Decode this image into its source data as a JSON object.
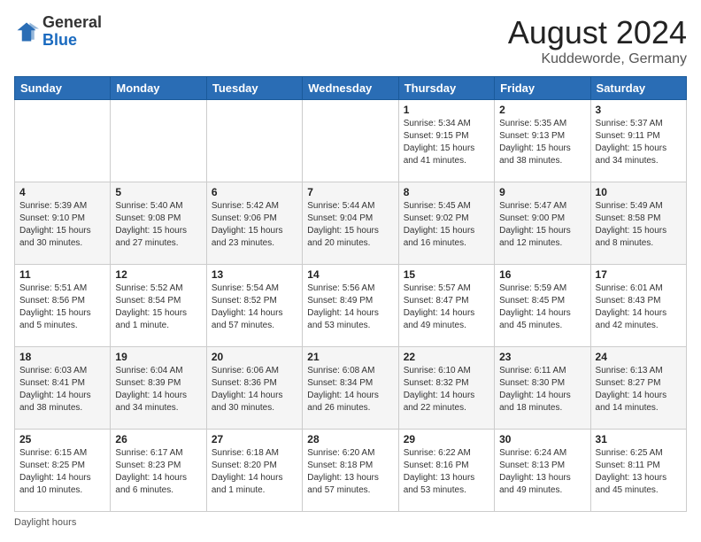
{
  "header": {
    "logo_general": "General",
    "logo_blue": "Blue",
    "month_year": "August 2024",
    "location": "Kuddeworde, Germany"
  },
  "days_of_week": [
    "Sunday",
    "Monday",
    "Tuesday",
    "Wednesday",
    "Thursday",
    "Friday",
    "Saturday"
  ],
  "weeks": [
    [
      {
        "day": "",
        "info": ""
      },
      {
        "day": "",
        "info": ""
      },
      {
        "day": "",
        "info": ""
      },
      {
        "day": "",
        "info": ""
      },
      {
        "day": "1",
        "info": "Sunrise: 5:34 AM\nSunset: 9:15 PM\nDaylight: 15 hours\nand 41 minutes."
      },
      {
        "day": "2",
        "info": "Sunrise: 5:35 AM\nSunset: 9:13 PM\nDaylight: 15 hours\nand 38 minutes."
      },
      {
        "day": "3",
        "info": "Sunrise: 5:37 AM\nSunset: 9:11 PM\nDaylight: 15 hours\nand 34 minutes."
      }
    ],
    [
      {
        "day": "4",
        "info": "Sunrise: 5:39 AM\nSunset: 9:10 PM\nDaylight: 15 hours\nand 30 minutes."
      },
      {
        "day": "5",
        "info": "Sunrise: 5:40 AM\nSunset: 9:08 PM\nDaylight: 15 hours\nand 27 minutes."
      },
      {
        "day": "6",
        "info": "Sunrise: 5:42 AM\nSunset: 9:06 PM\nDaylight: 15 hours\nand 23 minutes."
      },
      {
        "day": "7",
        "info": "Sunrise: 5:44 AM\nSunset: 9:04 PM\nDaylight: 15 hours\nand 20 minutes."
      },
      {
        "day": "8",
        "info": "Sunrise: 5:45 AM\nSunset: 9:02 PM\nDaylight: 15 hours\nand 16 minutes."
      },
      {
        "day": "9",
        "info": "Sunrise: 5:47 AM\nSunset: 9:00 PM\nDaylight: 15 hours\nand 12 minutes."
      },
      {
        "day": "10",
        "info": "Sunrise: 5:49 AM\nSunset: 8:58 PM\nDaylight: 15 hours\nand 8 minutes."
      }
    ],
    [
      {
        "day": "11",
        "info": "Sunrise: 5:51 AM\nSunset: 8:56 PM\nDaylight: 15 hours\nand 5 minutes."
      },
      {
        "day": "12",
        "info": "Sunrise: 5:52 AM\nSunset: 8:54 PM\nDaylight: 15 hours\nand 1 minute."
      },
      {
        "day": "13",
        "info": "Sunrise: 5:54 AM\nSunset: 8:52 PM\nDaylight: 14 hours\nand 57 minutes."
      },
      {
        "day": "14",
        "info": "Sunrise: 5:56 AM\nSunset: 8:49 PM\nDaylight: 14 hours\nand 53 minutes."
      },
      {
        "day": "15",
        "info": "Sunrise: 5:57 AM\nSunset: 8:47 PM\nDaylight: 14 hours\nand 49 minutes."
      },
      {
        "day": "16",
        "info": "Sunrise: 5:59 AM\nSunset: 8:45 PM\nDaylight: 14 hours\nand 45 minutes."
      },
      {
        "day": "17",
        "info": "Sunrise: 6:01 AM\nSunset: 8:43 PM\nDaylight: 14 hours\nand 42 minutes."
      }
    ],
    [
      {
        "day": "18",
        "info": "Sunrise: 6:03 AM\nSunset: 8:41 PM\nDaylight: 14 hours\nand 38 minutes."
      },
      {
        "day": "19",
        "info": "Sunrise: 6:04 AM\nSunset: 8:39 PM\nDaylight: 14 hours\nand 34 minutes."
      },
      {
        "day": "20",
        "info": "Sunrise: 6:06 AM\nSunset: 8:36 PM\nDaylight: 14 hours\nand 30 minutes."
      },
      {
        "day": "21",
        "info": "Sunrise: 6:08 AM\nSunset: 8:34 PM\nDaylight: 14 hours\nand 26 minutes."
      },
      {
        "day": "22",
        "info": "Sunrise: 6:10 AM\nSunset: 8:32 PM\nDaylight: 14 hours\nand 22 minutes."
      },
      {
        "day": "23",
        "info": "Sunrise: 6:11 AM\nSunset: 8:30 PM\nDaylight: 14 hours\nand 18 minutes."
      },
      {
        "day": "24",
        "info": "Sunrise: 6:13 AM\nSunset: 8:27 PM\nDaylight: 14 hours\nand 14 minutes."
      }
    ],
    [
      {
        "day": "25",
        "info": "Sunrise: 6:15 AM\nSunset: 8:25 PM\nDaylight: 14 hours\nand 10 minutes."
      },
      {
        "day": "26",
        "info": "Sunrise: 6:17 AM\nSunset: 8:23 PM\nDaylight: 14 hours\nand 6 minutes."
      },
      {
        "day": "27",
        "info": "Sunrise: 6:18 AM\nSunset: 8:20 PM\nDaylight: 14 hours\nand 1 minute."
      },
      {
        "day": "28",
        "info": "Sunrise: 6:20 AM\nSunset: 8:18 PM\nDaylight: 13 hours\nand 57 minutes."
      },
      {
        "day": "29",
        "info": "Sunrise: 6:22 AM\nSunset: 8:16 PM\nDaylight: 13 hours\nand 53 minutes."
      },
      {
        "day": "30",
        "info": "Sunrise: 6:24 AM\nSunset: 8:13 PM\nDaylight: 13 hours\nand 49 minutes."
      },
      {
        "day": "31",
        "info": "Sunrise: 6:25 AM\nSunset: 8:11 PM\nDaylight: 13 hours\nand 45 minutes."
      }
    ]
  ],
  "footer": {
    "daylight_label": "Daylight hours"
  }
}
